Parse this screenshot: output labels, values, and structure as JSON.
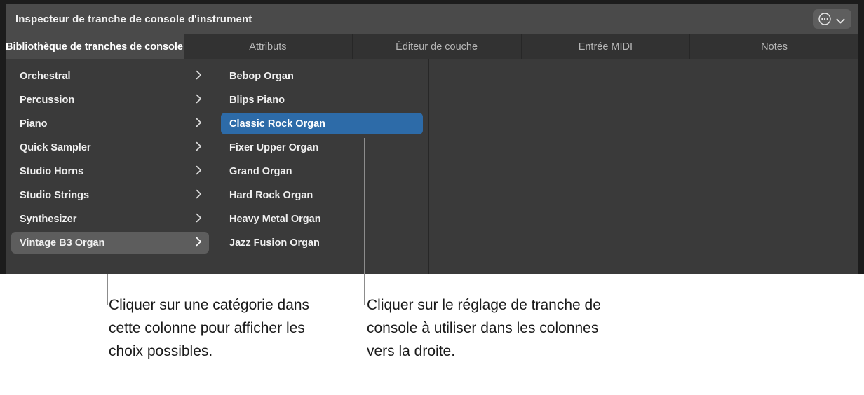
{
  "window": {
    "title": "Inspecteur de tranche de console d'instrument",
    "menu_button": {
      "icon": "ellipsis-circle-icon",
      "chevron": "chevron-down-icon"
    }
  },
  "tabs": [
    {
      "label": "Bibliothèque de tranches de console",
      "active": true
    },
    {
      "label": "Attributs",
      "active": false
    },
    {
      "label": "Éditeur de couche",
      "active": false
    },
    {
      "label": "Entrée MIDI",
      "active": false
    },
    {
      "label": "Notes",
      "active": false
    }
  ],
  "columns": {
    "categories": [
      {
        "label": "Orchestral",
        "state": "normal"
      },
      {
        "label": "Percussion",
        "state": "normal"
      },
      {
        "label": "Piano",
        "state": "normal"
      },
      {
        "label": "Quick Sampler",
        "state": "normal"
      },
      {
        "label": "Studio Horns",
        "state": "normal"
      },
      {
        "label": "Studio Strings",
        "state": "normal"
      },
      {
        "label": "Synthesizer",
        "state": "normal"
      },
      {
        "label": "Vintage B3 Organ",
        "state": "highlight"
      }
    ],
    "patches": [
      {
        "label": "Bebop Organ",
        "state": "normal"
      },
      {
        "label": "Blips Piano",
        "state": "normal"
      },
      {
        "label": "Classic Rock Organ",
        "state": "selected"
      },
      {
        "label": "Fixer Upper Organ",
        "state": "normal"
      },
      {
        "label": "Grand Organ",
        "state": "normal"
      },
      {
        "label": "Hard Rock Organ",
        "state": "normal"
      },
      {
        "label": "Heavy Metal Organ",
        "state": "normal"
      },
      {
        "label": "Jazz Fusion Organ",
        "state": "normal"
      }
    ]
  },
  "callouts": [
    {
      "text": "Cliquer sur une catégorie dans cette colonne pour afficher les choix possibles."
    },
    {
      "text": "Cliquer sur le réglage de tranche de console à utiliser dans les colonnes vers la droite."
    }
  ],
  "colors": {
    "selection_blue": "#2d6ba8",
    "highlight_gray": "#5d5d5d",
    "panel_bg": "#3a3a3a",
    "titlebar_bg": "#4a4a4a",
    "tabbar_bg": "#323232",
    "callout_line": "#8c8c8c"
  }
}
